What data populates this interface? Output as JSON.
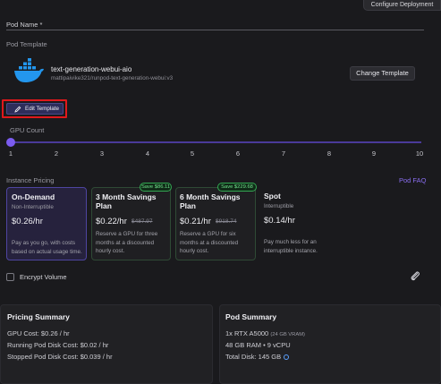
{
  "header": {
    "configure_button": "Configure Deployment"
  },
  "pod_name": {
    "label": "Pod Name *",
    "value": ""
  },
  "template": {
    "section_label": "Pod Template",
    "name": "text-generation-webui-aio",
    "image": "mattipaivike321/runpod-text-generation-webui:v3",
    "change_button": "Change Template",
    "edit_button": "Edit Template"
  },
  "gpu_count": {
    "label": "GPU Count",
    "ticks": [
      "1",
      "2",
      "3",
      "4",
      "5",
      "6",
      "7",
      "8",
      "9",
      "10"
    ],
    "selected": 1
  },
  "pricing": {
    "section_label": "Instance Pricing",
    "faq_link": "Pod FAQ",
    "cards": [
      {
        "title": "On-Demand",
        "subtitle": "Non-Interruptible",
        "price": "$0.26/hr",
        "old_price": "",
        "badge": "",
        "description": "Pay as you go, with costs based on actual usage time."
      },
      {
        "title": "3 Month Savings Plan",
        "subtitle": "",
        "price": "$0.22/hr",
        "old_price": "$487.97",
        "badge": "Save $86.11",
        "description": "Reserve a GPU for three months at a discounted hourly cost."
      },
      {
        "title": "6 Month Savings Plan",
        "subtitle": "",
        "price": "$0.21/hr",
        "old_price": "$918.74",
        "badge": "Save $229.68",
        "description": "Reserve a GPU for six months at a discounted hourly cost."
      },
      {
        "title": "Spot",
        "subtitle": "Interruptible",
        "price": "$0.14/hr",
        "old_price": "",
        "badge": "",
        "description": "Pay much less for an interruptible instance."
      }
    ]
  },
  "encrypt": {
    "label": "Encrypt Volume",
    "checked": false
  },
  "pricing_summary": {
    "title": "Pricing Summary",
    "lines": [
      "GPU Cost: $0.26 / hr",
      "Running Pod Disk Cost: $0.02 / hr",
      "Stopped Pod Disk Cost: $0.039 / hr"
    ]
  },
  "pod_summary": {
    "title": "Pod Summary",
    "gpu": "1x RTX A5000",
    "vram": "(24 GB VRAM)",
    "ram_cpu": "48 GB RAM • 9 vCPU",
    "disk": "Total Disk: 145 GB"
  },
  "colors": {
    "accent": "#7b5cf0",
    "save_green": "#34a853",
    "highlight_red": "#e0181b"
  }
}
